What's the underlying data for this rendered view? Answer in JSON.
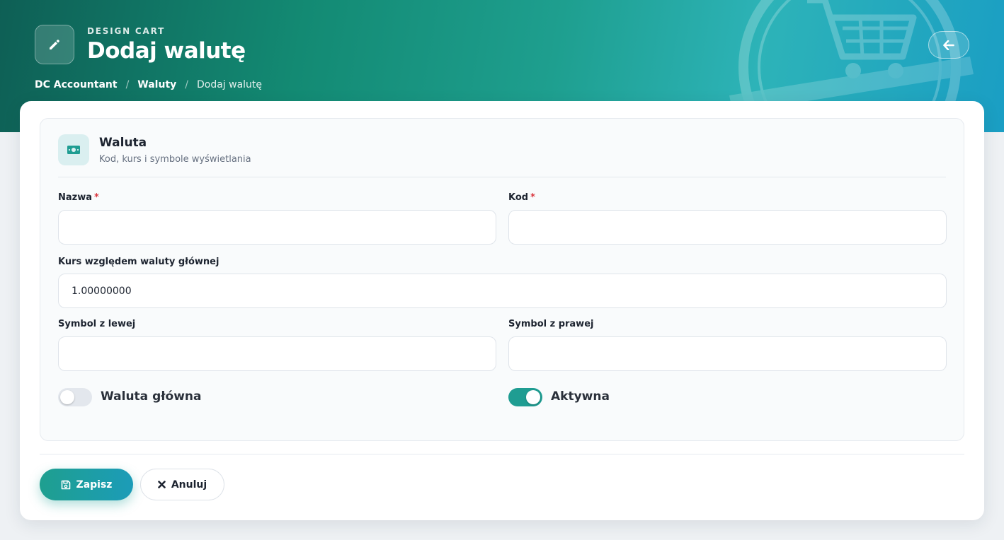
{
  "header": {
    "eyebrow": "DESIGN CART",
    "title": "Dodaj walutę",
    "breadcrumb": [
      {
        "label": "DC Accountant"
      },
      {
        "label": "Waluty"
      },
      {
        "label": "Dodaj walutę"
      }
    ],
    "icons": {
      "page": "pencil-icon",
      "back": "arrow-left-icon",
      "watermark": "shopping-cart-icon"
    }
  },
  "panel": {
    "title": "Waluta",
    "subtitle": "Kod, kurs i symbole wyświetlania",
    "icon": "banknote-icon"
  },
  "form": {
    "name": {
      "label": "Nazwa",
      "required_mark": "*",
      "value": ""
    },
    "code": {
      "label": "Kod",
      "required_mark": "*",
      "value": ""
    },
    "rate": {
      "label": "Kurs względem waluty głównej",
      "value": "1.00000000"
    },
    "symbol_left": {
      "label": "Symbol z lewej",
      "value": ""
    },
    "symbol_right": {
      "label": "Symbol z prawej",
      "value": ""
    },
    "main_currency": {
      "label": "Waluta główna",
      "checked": false
    },
    "active": {
      "label": "Aktywna",
      "checked": true
    }
  },
  "actions": {
    "save_label": "Zapisz",
    "cancel_label": "Anuluj",
    "save_icon": "floppy-disk-icon",
    "cancel_icon": "x-icon"
  },
  "colors": {
    "accent": "#1f9d92",
    "required": "#d9363e"
  }
}
